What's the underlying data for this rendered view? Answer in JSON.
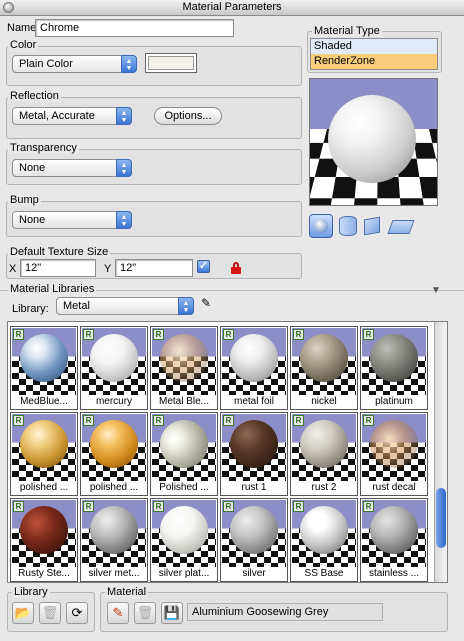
{
  "window": {
    "title": "Material Parameters"
  },
  "name": {
    "label": "Name",
    "value": "Chrome"
  },
  "color": {
    "label": "Color",
    "selected": "Plain Color",
    "swatch": "#f4f1ea"
  },
  "reflection": {
    "label": "Reflection",
    "selected": "Metal, Accurate",
    "options_button": "Options..."
  },
  "transparency": {
    "label": "Transparency",
    "selected": "None"
  },
  "bump": {
    "label": "Bump",
    "selected": "None"
  },
  "texture": {
    "label": "Default Texture Size",
    "x_label": "X",
    "x_value": "12\"",
    "y_label": "Y",
    "y_value": "12\"",
    "linked": true
  },
  "material_type": {
    "label": "Material Type",
    "items": [
      {
        "label": "Shaded",
        "selected": false
      },
      {
        "label": "RenderZone",
        "selected": true
      }
    ]
  },
  "libraries": {
    "label": "Material Libraries",
    "library_label": "Library:",
    "library_selected": "Metal",
    "thumbnails": [
      {
        "label": "MedBlue...",
        "ball": "radial-gradient(circle at 35% 30%,#ffffff 0,#dce8f4 20%,#6d93be 55%,#2b4870 100%)"
      },
      {
        "label": "mercury",
        "ball": "radial-gradient(circle at 38% 30%,#ffffff 0,#f3f3f3 35%,#c4c4c4 70%,#7b7b7b 100%)"
      },
      {
        "label": "Metal Ble...",
        "ball": "radial-gradient(circle at 40% 35%,rgba(255,240,210,.9) 0,rgba(220,170,110,.55) 40%,rgba(120,90,60,.35) 75%,rgba(80,60,40,.2) 100%)"
      },
      {
        "label": "metal foil",
        "ball": "radial-gradient(circle at 40% 30%,#ffffff 0,#eeeeee 30%,#bbbbbb 65%,#777777 100%)"
      },
      {
        "label": "nickel",
        "ball": "radial-gradient(circle at 35% 30%,#dcd4c4 0,#a69c88 35%,#6c6454 70%,#3a342a 100%)"
      },
      {
        "label": "platinum",
        "ball": "radial-gradient(circle at 35% 30%,#bdbdb8 0,#8c8c86 35%,#5a5a55 70%,#2c2c2a 100%)"
      },
      {
        "label": "polished ...",
        "ball": "radial-gradient(circle at 38% 30%,#fff4d8 0,#f1cf82 25%,#c8922e 60%,#6a4610 100%)"
      },
      {
        "label": "polished ...",
        "ball": "radial-gradient(circle at 38% 30%,#fff0c8 0,#f5c060 25%,#d08a1c 60%,#7a4808 100%)"
      },
      {
        "label": "Polished ...",
        "ball": "radial-gradient(circle at 30% 40%,#ffffff 0,#f0efe6 20%,#b5b3a4 55%,#6e6c60 100%)"
      },
      {
        "label": "rust 1",
        "ball": "radial-gradient(circle at 35% 30%,#8a6a55 0,#5a3a2a 35%,#3a2418 70%,#1e120a 100%)"
      },
      {
        "label": "rust 2",
        "ball": "radial-gradient(circle at 35% 30%,#f2f0ea 0,#cfcac0 35%,#908a80 70%,#4e4a44 100%)"
      },
      {
        "label": "rust decal",
        "ball": "radial-gradient(circle at 40% 40%,rgba(255,230,190,.9) 0,rgba(210,150,90,.55) 40%,rgba(120,80,50,.35) 75%,rgba(70,50,30,.2) 100%)"
      },
      {
        "label": "Rusty Ste...",
        "ball": "radial-gradient(circle at 35% 35%,#c0523a 0,#7a2a1a 40%,#4a1a10 75%,#200a06 100%)"
      },
      {
        "label": "silver met...",
        "ball": "radial-gradient(circle at 35% 30%,#f0f0f0 0,#bdbdbd 35%,#7a7a7a 70%,#3e3e3e 100%)"
      },
      {
        "label": "silver plat...",
        "ball": "radial-gradient(circle at 38% 30%,#ffffff 0,#f6f6f2 35%,#c6c6c0 70%,#7e7e78 100%)"
      },
      {
        "label": "silver",
        "ball": "radial-gradient(circle at 35% 30%,#ededed 0,#c4c4c4 35%,#858585 70%,#474747 100%)"
      },
      {
        "label": "SS Base",
        "ball": "radial-gradient(circle at 38% 32%,#ffffff 0,#ffffff 20%,#c4c4c4 55%,#5e5e5e 100%)"
      },
      {
        "label": "stainless ...",
        "ball": "radial-gradient(circle at 35% 30%,#e6e6e6 0,#b6b6b6 35%,#767676 70%,#3c3c3c 100%)"
      }
    ]
  },
  "bottom": {
    "library_label": "Library",
    "material_label": "Material",
    "material_name": "Aluminium Goosewing Grey"
  },
  "icons": {
    "edit": "pencil-icon",
    "trash": "trash-icon",
    "refresh": "refresh-icon",
    "save": "save-icon",
    "lock": "lock-icon"
  }
}
